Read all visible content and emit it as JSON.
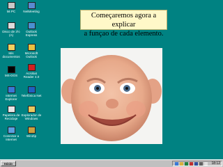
{
  "caption": {
    "line1": "Começaremos agora a explicar",
    "line2": "a funçao de cada elemento."
  },
  "desktop_icons": [
    {
      "name": "my-computer-icon",
      "label": "Mi PC"
    },
    {
      "name": "netmeeting-icon",
      "label": "NetMeeting"
    },
    {
      "name": "floppy-icon",
      "label": "Disco de 3½ (A)"
    },
    {
      "name": "outlook-express-icon",
      "label": "Outlook Express"
    },
    {
      "name": "my-documents-icon",
      "label": "Mis documentos"
    },
    {
      "name": "microsoft-outlook-icon",
      "label": "Microsoft Outlook"
    },
    {
      "name": "msdos-icon",
      "label": "MS-DOS"
    },
    {
      "name": "acrobat-reader-icon",
      "label": "Acrobat Reader 4.0"
    },
    {
      "name": "internet-explorer-icon",
      "label": "Internet Explorer"
    },
    {
      "name": "telefonica-net-icon",
      "label": "Telefónica Net"
    },
    {
      "name": "recycle-bin-icon",
      "label": "Papelera de Reciclaje"
    },
    {
      "name": "windows-explorer-icon",
      "label": "Explorador de Windows"
    },
    {
      "name": "connect-internet-icon",
      "label": "Conectar a Internet"
    },
    {
      "name": "winzip-icon",
      "label": "WinZip"
    }
  ],
  "taskbar": {
    "start_label": "Inicio",
    "clock": "18:12"
  },
  "colors": {
    "desktop": "#008282",
    "taskbar": "#c0c0c0",
    "caption_bg": "#fff8c8"
  }
}
